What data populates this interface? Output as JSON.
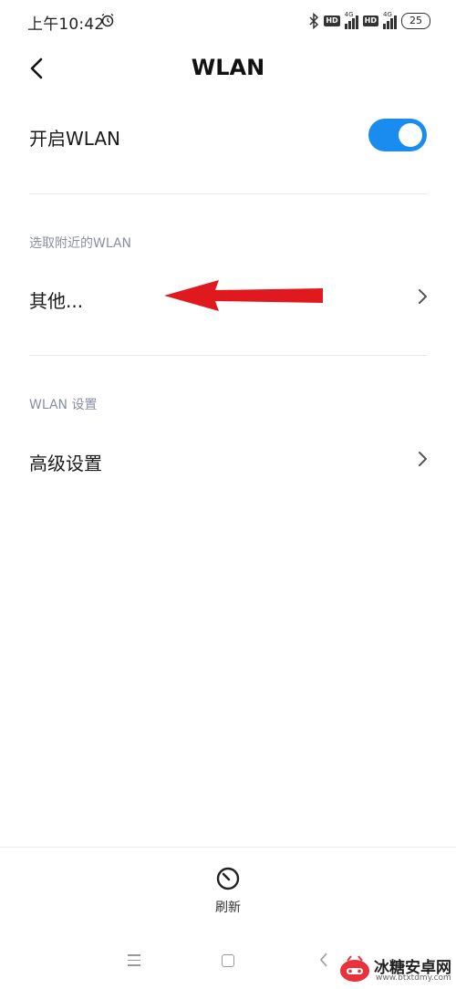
{
  "status_bar": {
    "time": "上午10:42",
    "hd1": "HD",
    "net1": "4G",
    "hd2": "HD",
    "net2": "4G",
    "battery": "25"
  },
  "header": {
    "title": "WLAN"
  },
  "wlan_toggle": {
    "label": "开启WLAN",
    "enabled": true
  },
  "nearby_section": {
    "title": "选取附近的WLAN",
    "items": [
      {
        "label": "其他..."
      }
    ]
  },
  "settings_section": {
    "title": "WLAN 设置",
    "items": [
      {
        "label": "高级设置"
      }
    ]
  },
  "bottom_bar": {
    "refresh_label": "刷新"
  },
  "watermark": {
    "title": "冰糖安卓网",
    "url": "www.btxtdmy.com"
  },
  "colors": {
    "accent": "#1a8cf0",
    "annotation_arrow": "#e0191f"
  }
}
